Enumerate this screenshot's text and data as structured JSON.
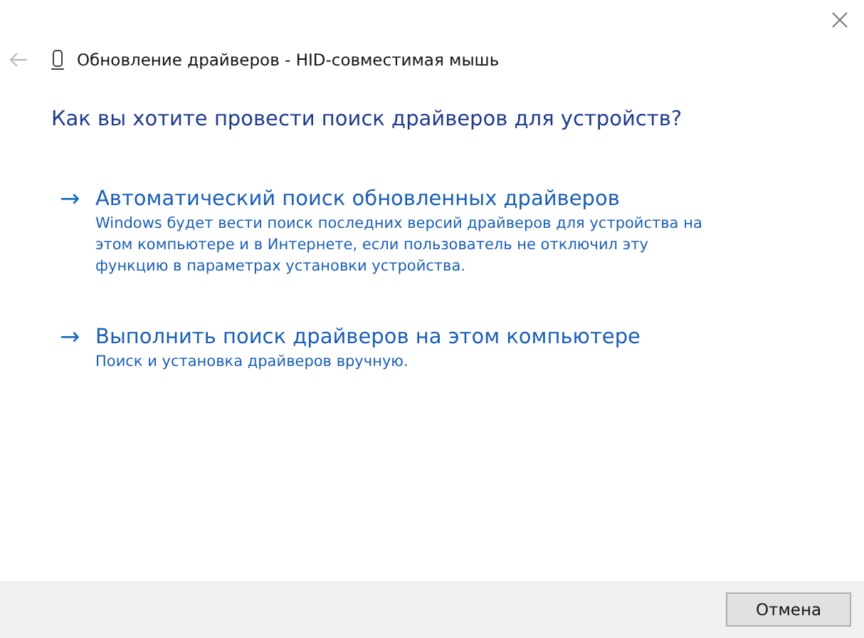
{
  "window": {
    "title": "Обновление драйверов - HID-совместимая мышь"
  },
  "heading": "Как вы хотите провести поиск драйверов для устройств?",
  "options": [
    {
      "arrow": "→",
      "label": "Автоматический поиск обновленных драйверов",
      "description": "Windows будет вести поиск последних версий драйверов для устройства на этом компьютере и в Интернете, если пользователь не отключил эту функцию в параметрах установки устройства."
    },
    {
      "arrow": "→",
      "label": "Выполнить поиск драйверов на этом компьютере",
      "description": "Поиск и установка драйверов вручную."
    }
  ],
  "buttons": [
    "Отмена"
  ]
}
